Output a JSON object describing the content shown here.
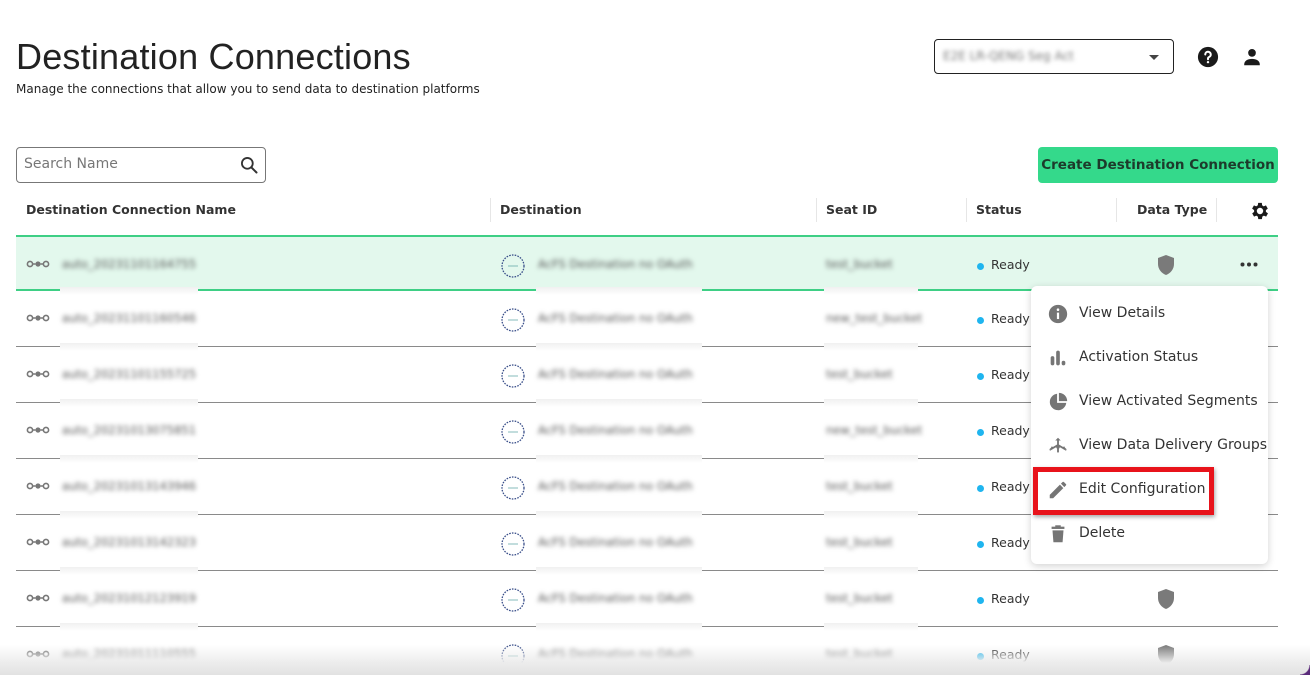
{
  "header": {
    "title": "Destination Connections",
    "subtitle": "Manage the connections that allow you to send data to destination platforms",
    "account_selector": {
      "value": "E2E LR-QENG Seg Act",
      "icon": "caret-down-icon"
    },
    "help_icon": "help-circle-icon",
    "user_icon": "user-icon"
  },
  "toolbar": {
    "search": {
      "placeholder": "Search Name",
      "value": "",
      "icon": "search-icon"
    },
    "create_button": "Create Destination Connection"
  },
  "table": {
    "columns": [
      {
        "label": "Destination Connection Name"
      },
      {
        "label": "Destination"
      },
      {
        "label": "Seat ID"
      },
      {
        "label": "Status"
      },
      {
        "label": "Data Type"
      }
    ],
    "settings_icon": "gear-icon",
    "rows": [
      {
        "name": "auto_20231101164755",
        "destination": "AcFS Destination no OAuth",
        "seat_id": "test_bucket",
        "status": "Ready",
        "data_type_icon": "shield-icon",
        "selected": true,
        "has_more": true
      },
      {
        "name": "auto_20231101160546",
        "destination": "AcFS Destination no OAuth",
        "seat_id": "new_test_bucket",
        "status": "Ready",
        "data_type_icon": "",
        "selected": false,
        "has_more": false
      },
      {
        "name": "auto_20231101155725",
        "destination": "AcFS Destination no OAuth",
        "seat_id": "test_bucket",
        "status": "Ready",
        "data_type_icon": "",
        "selected": false,
        "has_more": false
      },
      {
        "name": "auto_20231013075851",
        "destination": "AcFS Destination no OAuth",
        "seat_id": "new_test_bucket",
        "status": "Ready",
        "data_type_icon": "",
        "selected": false,
        "has_more": false
      },
      {
        "name": "auto_20231013143946",
        "destination": "AcFS Destination no OAuth",
        "seat_id": "test_bucket",
        "status": "Ready",
        "data_type_icon": "",
        "selected": false,
        "has_more": false
      },
      {
        "name": "auto_20231013142323",
        "destination": "AcFS Destination no OAuth",
        "seat_id": "test_bucket",
        "status": "Ready",
        "data_type_icon": "",
        "selected": false,
        "has_more": false
      },
      {
        "name": "auto_20231012123919",
        "destination": "AcFS Destination no OAuth",
        "seat_id": "test_bucket",
        "status": "Ready",
        "data_type_icon": "shield-icon",
        "selected": false,
        "has_more": false
      },
      {
        "name": "auto_20231011110555",
        "destination": "AcFS Destination no OAuth",
        "seat_id": "test_bucket",
        "status": "Ready",
        "data_type_icon": "shield-icon",
        "selected": false,
        "has_more": false
      }
    ]
  },
  "context_menu": {
    "items": [
      {
        "label": "View Details",
        "icon": "info-icon"
      },
      {
        "label": "Activation Status",
        "icon": "bar-chart-icon"
      },
      {
        "label": "View Activated Segments",
        "icon": "pie-chart-icon"
      },
      {
        "label": "View Data Delivery Groups",
        "icon": "hub-arrows-icon"
      },
      {
        "label": "Edit Configuration",
        "icon": "pencil-icon",
        "highlighted": true
      },
      {
        "label": "Delete",
        "icon": "trash-icon"
      }
    ]
  },
  "colors": {
    "primary_green": "#34d98b",
    "selected_row_bg": "#e3f8ed",
    "selected_row_border": "#3ecf85",
    "status_ready": "#1fb5ef",
    "highlight_red": "#e8131b"
  }
}
